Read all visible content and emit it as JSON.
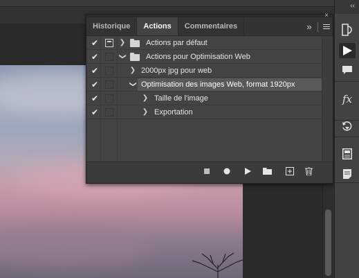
{
  "panel": {
    "tabs": [
      {
        "label": "Historique",
        "active": false
      },
      {
        "label": "Actions",
        "active": true
      },
      {
        "label": "Commentaires",
        "active": false
      }
    ],
    "close_glyph": "×",
    "expand_glyph": "»",
    "rows": [
      {
        "label": "Actions par défaut",
        "checked": true,
        "dialog": true,
        "expanded": false,
        "level": 0,
        "folder": true
      },
      {
        "label": "Actions pour Optimisation Web",
        "checked": true,
        "dialog": false,
        "expanded": true,
        "level": 0,
        "folder": true
      },
      {
        "label": "2000px jpg pour web",
        "checked": true,
        "dialog": false,
        "expanded": false,
        "level": 1,
        "folder": false
      },
      {
        "label": "Optimisation des images Web, format 1920px",
        "checked": true,
        "dialog": false,
        "expanded": true,
        "level": 1,
        "folder": false,
        "selected": true
      },
      {
        "label": "Taille de l'image",
        "checked": true,
        "dialog": false,
        "expanded": false,
        "level": 2,
        "folder": false
      },
      {
        "label": "Exportation",
        "checked": true,
        "dialog": false,
        "expanded": false,
        "level": 2,
        "folder": false
      }
    ],
    "footer_icons": [
      "stop-icon",
      "record-icon",
      "play-icon",
      "folder-icon",
      "new-action-icon",
      "trash-icon"
    ]
  },
  "dock": {
    "collapse_glyph": "‹‹",
    "icons": [
      "history-icon",
      "play-actions-icon",
      "comment-icon",
      "fx-styles-icon",
      "timeline-icon",
      "properties-icon",
      "notes-icon"
    ]
  },
  "colors": {
    "accent_selected": "#595959",
    "panel_bg": "#434343"
  }
}
